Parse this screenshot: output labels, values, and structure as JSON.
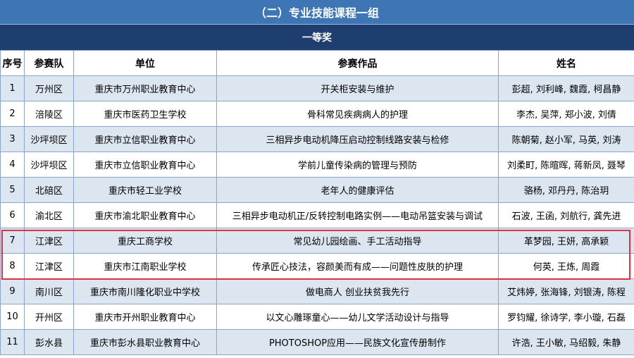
{
  "title": "（二）专业技能课程一组",
  "award": "一等奖",
  "columns": [
    "序号",
    "参赛队",
    "单位",
    "参赛作品",
    "姓名"
  ],
  "rows": [
    {
      "no": "1",
      "team": "万州区",
      "unit": "重庆市万州职业教育中心",
      "work": "开关柜安装与维护",
      "names": "彭超, 刘利峰, 魏霞, 柯昌静"
    },
    {
      "no": "2",
      "team": "涪陵区",
      "unit": "重庆市医药卫生学校",
      "work": "骨科常见疾病病人的护理",
      "names": "李杰, 吴萍, 郑小波, 刘倩"
    },
    {
      "no": "3",
      "team": "沙坪坝区",
      "unit": "重庆市立信职业教育中心",
      "work": "三相异步电动机降压启动控制线路安装与检修",
      "names": "陈朝菊, 赵小军, 马英, 刘涛"
    },
    {
      "no": "4",
      "team": "沙坪坝区",
      "unit": "重庆市立信职业教育中心",
      "work": "学前儿童传染病的管理与预防",
      "names": "刘柔町, 陈暄晖, 蒋新凤, 聂琴"
    },
    {
      "no": "5",
      "team": "北碚区",
      "unit": "重庆市轻工业学校",
      "work": "老年人的健康评估",
      "names": "骆杨, 邓丹丹, 陈治玥"
    },
    {
      "no": "6",
      "team": "渝北区",
      "unit": "重庆市渝北职业教育中心",
      "work": "三相异步电动机正/反转控制电路实例——电动吊篮安装与调试",
      "names": "石波, 王函, 刘航行, 龚先进"
    },
    {
      "no": "7",
      "team": "江津区",
      "unit": "重庆工商学校",
      "work": "常见幼儿园绘画、手工活动指导",
      "names": "革梦园, 王妍, 高承颖"
    },
    {
      "no": "8",
      "team": "江津区",
      "unit": "重庆市江南职业学校",
      "work": "传承匠心技法，容颜美而有成——问题性皮肤的护理",
      "names": "何英, 王炼, 周霞"
    },
    {
      "no": "9",
      "team": "南川区",
      "unit": "重庆市南川隆化职业中学校",
      "work": "做电商人  创业扶贫我先行",
      "names": "艾炜婷, 张海锋, 刘银涛, 陈程"
    },
    {
      "no": "10",
      "team": "开州区",
      "unit": "重庆市开州职业教育中心",
      "work": "以文心雕琢童心——幼儿文学活动设计与指导",
      "names": "罗钧耀, 徐诗学, 李小璇, 石磊"
    },
    {
      "no": "11",
      "team": "彭水县",
      "unit": "重庆市彭水县职业教育中心",
      "work": "PHOTOSHOP应用——民族文化宣传册制作",
      "names": "许浩, 王小敏, 马绍毅, 朱静"
    }
  ]
}
